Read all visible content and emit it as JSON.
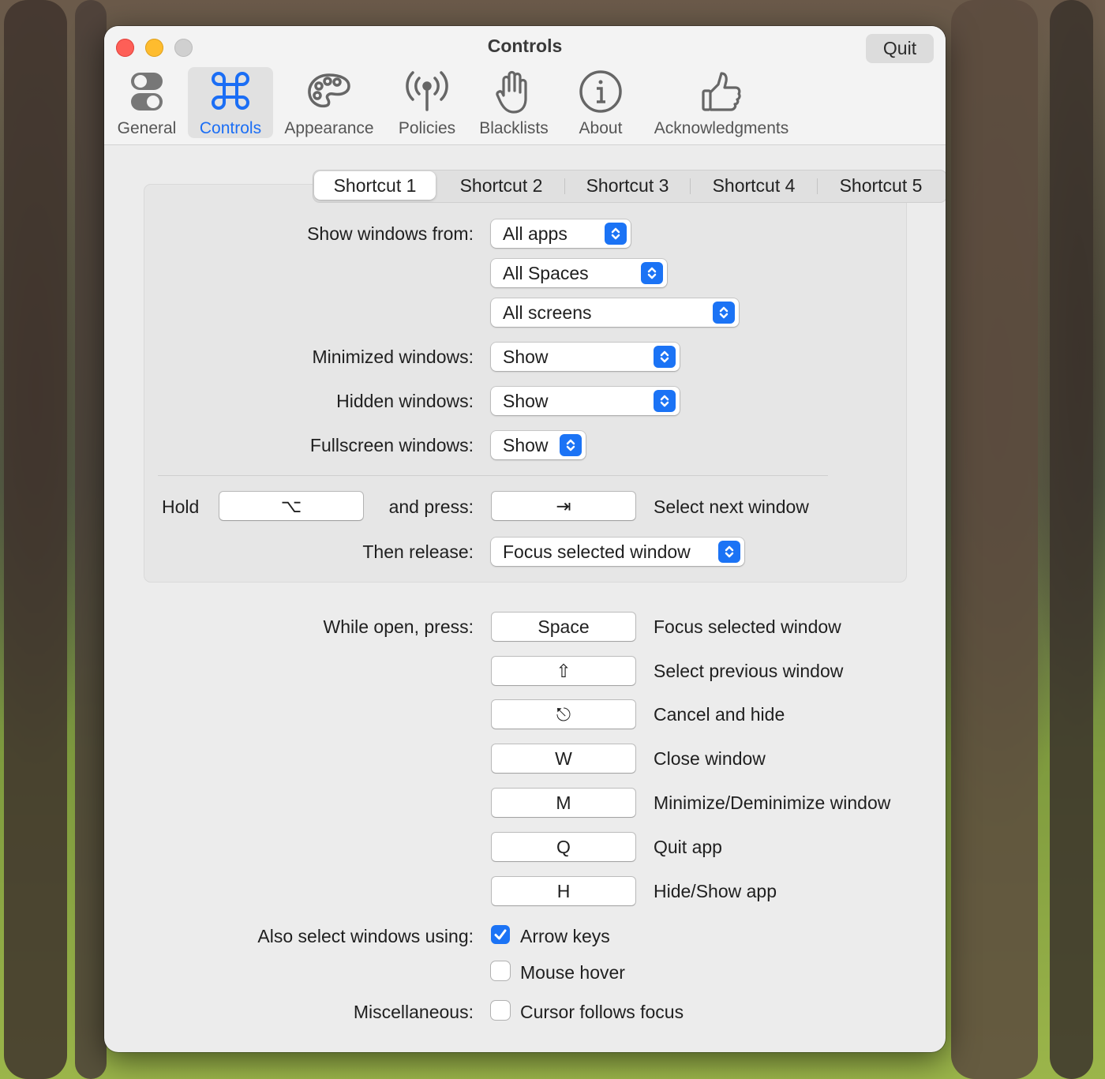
{
  "window": {
    "title": "Controls",
    "quit_label": "Quit"
  },
  "toolbar": {
    "items": [
      {
        "label": "General",
        "icon": "toggle-icon"
      },
      {
        "label": "Controls",
        "icon": "command-icon"
      },
      {
        "label": "Appearance",
        "icon": "palette-icon"
      },
      {
        "label": "Policies",
        "icon": "antenna-icon"
      },
      {
        "label": "Blacklists",
        "icon": "hand-icon"
      },
      {
        "label": "About",
        "icon": "info-icon"
      },
      {
        "label": "Acknowledgments",
        "icon": "thumbs-up-icon"
      }
    ],
    "active": "Controls"
  },
  "shortcut_tabs": [
    "Shortcut 1",
    "Shortcut 2",
    "Shortcut 3",
    "Shortcut 4",
    "Shortcut 5"
  ],
  "shortcut_tabs_selected": "Shortcut 1",
  "settings": {
    "show_windows_from_label": "Show windows from:",
    "apps_value": "All apps",
    "spaces_value": "All Spaces",
    "screens_value": "All screens",
    "minimized_label": "Minimized windows:",
    "minimized_value": "Show",
    "hidden_label": "Hidden windows:",
    "hidden_value": "Show",
    "fullscreen_label": "Fullscreen windows:",
    "fullscreen_value": "Show",
    "hold_label": "Hold",
    "hold_key": "⌥",
    "and_press_label": "and press:",
    "press_key": "⇥",
    "select_next_label": "Select next window",
    "then_release_label": "Then release:",
    "release_value": "Focus selected window"
  },
  "while_open": {
    "label": "While open, press:",
    "rows": [
      {
        "key": "Space",
        "action": "Focus selected window"
      },
      {
        "key": "⇧",
        "action": "Select previous window"
      },
      {
        "key": "⎋",
        "action": "Cancel and hide"
      },
      {
        "key": "W",
        "action": "Close window"
      },
      {
        "key": "M",
        "action": "Minimize/Deminimize window"
      },
      {
        "key": "Q",
        "action": "Quit app"
      },
      {
        "key": "H",
        "action": "Hide/Show app"
      }
    ]
  },
  "also_select": {
    "label": "Also select windows using:",
    "arrow_keys": "Arrow keys",
    "arrow_keys_checked": true,
    "mouse_hover": "Mouse hover",
    "mouse_hover_checked": false
  },
  "misc": {
    "label": "Miscellaneous:",
    "cursor_follows_focus": "Cursor follows focus",
    "cursor_follows_focus_checked": false
  },
  "colors": {
    "accent": "#1b73f5",
    "close": "#fe5f57",
    "minimize": "#febc2e",
    "zoom_disabled": "#d0d0d0"
  }
}
